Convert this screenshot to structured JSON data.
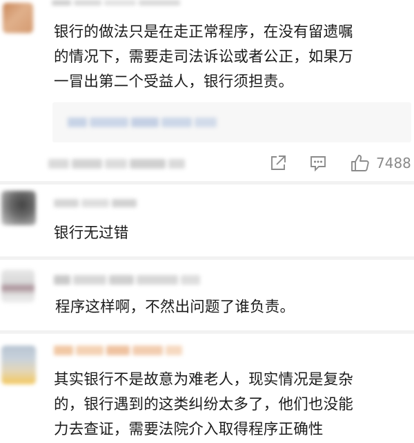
{
  "comments": [
    {
      "text": "银行的做法只是在走正常程序，在没有留遗嘱的情况下，需要走司法诉讼或者公正，如果万一冒出第二个受益人，银行须担责。",
      "lines": [
        "银行的做法只是在走正常程序，在没有留遗嘱",
        "的情况下，需要走司法诉讼或者公正，如果万",
        "一冒出第二个受益人，银行须担责。"
      ],
      "like_count": "7488"
    },
    {
      "text": "银行无过错",
      "lines": [
        "银行无过错"
      ]
    },
    {
      "text": "程序这样啊，不然出问题了谁负责。",
      "lines": [
        "程序这样啊，不然出问题了谁负责。"
      ]
    },
    {
      "text": "其实银行不是故意为难老人，现实情况是复杂的，银行遇到的这类纠纷太多了，他们也没能力去查证，需要法院介入取得程序正确性",
      "lines": [
        "其实银行不是故意为难老人，现实情况是复杂",
        "的，银行遇到的这类纠纷太多了，他们也没能",
        "力去查证，需要法院介入取得程序正确性"
      ]
    }
  ],
  "icons": {
    "share": "share-icon",
    "comment": "comment-icon",
    "like": "thumbs-up-icon"
  },
  "colors": {
    "text": "#1b1b1b",
    "meta": "#8a8a8a",
    "divider": "#f2f2f2"
  }
}
